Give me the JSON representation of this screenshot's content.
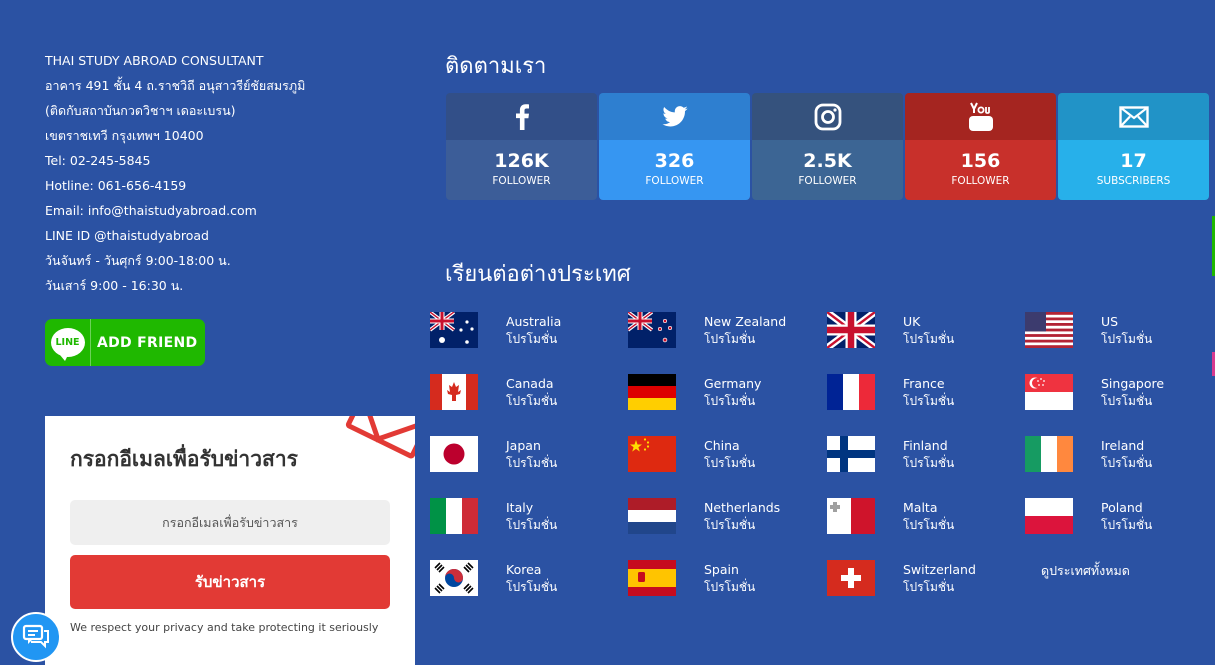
{
  "contact": {
    "lines": [
      "THAI STUDY ABROAD CONSULTANT",
      "อาคาร 491 ชั้น 4 ถ.ราชวิถี อนุสาวรีย์ชัยสมรภูมิ",
      "(ติดกับสถาบันกวดวิชาฯ เดอะเบรน)",
      "เขตราชเทวี กรุงเทพฯ 10400",
      "Tel: 02-245-5845",
      "Hotline: 061-656-4159",
      "Email: info@thaistudyabroad.com",
      "LINE ID @thaistudyabroad",
      "วันจันทร์ - วันศุกร์ 9:00-18:00 น.",
      "วันเสาร์ 9:00 - 16:30 น."
    ],
    "line_logo": "LINE",
    "add_friend_label": "ADD FRIEND"
  },
  "newsletter": {
    "title": "กรอกอีเมลเพื่อรับข่าวสาร",
    "placeholder": "กรอกอีเมลเพื่อรับข่าวสาร",
    "button_label": "รับข่าวสาร",
    "privacy": "We respect your privacy and take protecting it seriously"
  },
  "follow": {
    "title": "ติดตามเรา",
    "tiles": [
      {
        "network": "facebook",
        "icon": "facebook-icon",
        "count": "126K",
        "label": "FOLLOWER"
      },
      {
        "network": "twitter",
        "icon": "twitter-icon",
        "count": "326",
        "label": "FOLLOWER"
      },
      {
        "network": "instagram",
        "icon": "instagram-icon",
        "count": "2.5K",
        "label": "FOLLOWER"
      },
      {
        "network": "youtube",
        "icon": "youtube-icon",
        "count": "156",
        "label": "FOLLOWER"
      },
      {
        "network": "email",
        "icon": "mail-icon",
        "count": "17",
        "label": "SUBSCRIBERS"
      }
    ]
  },
  "study": {
    "title": "เรียนต่อต่างประเทศ",
    "promo_label": "โปรโมชั่น",
    "countries": [
      "Australia",
      "New Zealand",
      "UK",
      "US",
      "Canada",
      "Germany",
      "France",
      "Singapore",
      "Japan",
      "China",
      "Finland",
      "Ireland",
      "Italy",
      "Netherlands",
      "Malta",
      "Poland",
      "Korea",
      "Spain",
      "Switzerland"
    ],
    "all_label": "ดูประเทศทั้งหมด"
  },
  "colors": {
    "background": "#2b52a3",
    "line_green": "#1fb800",
    "red": "#e23a35",
    "facebook": "#3c5d98",
    "twitter": "#3696f2",
    "instagram": "#3c6594",
    "youtube": "#c8302b",
    "email": "#27b0ea"
  }
}
